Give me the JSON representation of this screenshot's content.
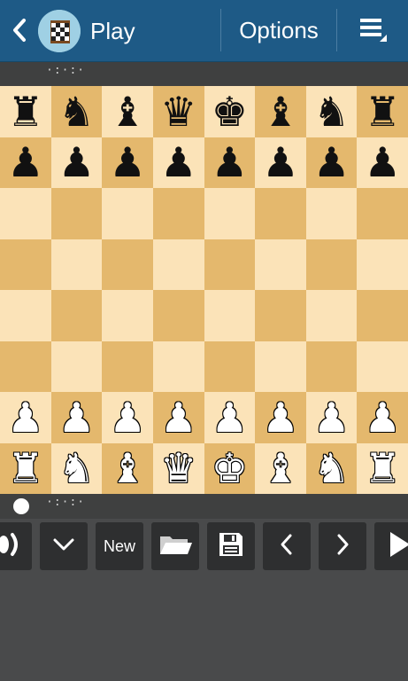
{
  "actionbar": {
    "title": "Play",
    "options_label": "Options"
  },
  "clock": {
    "top_text": "·:·:·",
    "bottom_text": "·:·:·"
  },
  "board": {
    "light_color": "#fbe3b8",
    "dark_color": "#e4b86d",
    "rows": [
      [
        "r",
        "n",
        "b",
        "q",
        "k",
        "b",
        "n",
        "r"
      ],
      [
        "p",
        "p",
        "p",
        "p",
        "p",
        "p",
        "p",
        "p"
      ],
      [
        "",
        "",
        "",
        "",
        "",
        "",
        "",
        ""
      ],
      [
        "",
        "",
        "",
        "",
        "",
        "",
        "",
        ""
      ],
      [
        "",
        "",
        "",
        "",
        "",
        "",
        "",
        ""
      ],
      [
        "",
        "",
        "",
        "",
        "",
        "",
        "",
        ""
      ],
      [
        "P",
        "P",
        "P",
        "P",
        "P",
        "P",
        "P",
        "P"
      ],
      [
        "R",
        "N",
        "B",
        "Q",
        "K",
        "B",
        "N",
        "R"
      ]
    ]
  },
  "toolbar": {
    "new_label": "New",
    "buttons": [
      "speaker-icon",
      "chevron-down-icon",
      "new",
      "folder-open-icon",
      "save-icon",
      "prev-move-icon",
      "next-move-icon",
      "play-icon"
    ]
  },
  "colors": {
    "actionbar": "#1e5a86",
    "background": "#494a4b",
    "button": "#2e2f30"
  }
}
